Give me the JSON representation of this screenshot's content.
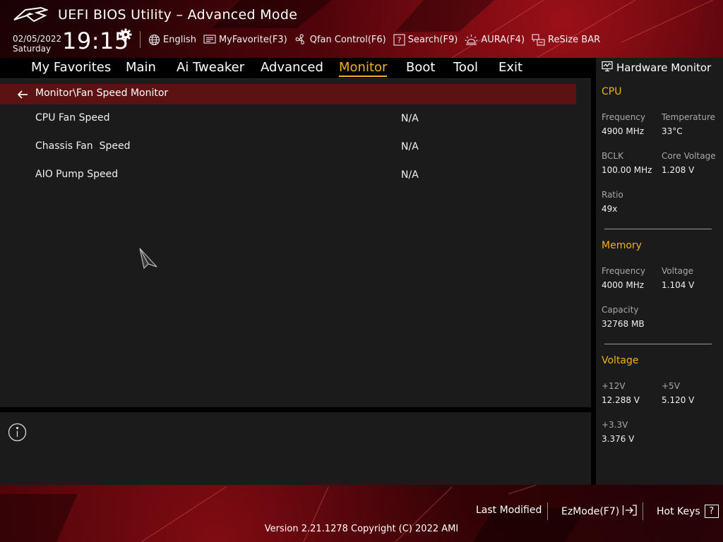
{
  "header": {
    "title": "UEFI BIOS Utility – Advanced Mode",
    "date": "02/05/2022",
    "day": "Saturday",
    "time": "19:15"
  },
  "toolbar": {
    "items": [
      {
        "label": "English",
        "icon": "globe-icon"
      },
      {
        "label": "MyFavorite(F3)",
        "icon": "favorite-icon"
      },
      {
        "label": "Qfan Control(F6)",
        "icon": "fan-icon"
      },
      {
        "label": "Search(F9)",
        "icon": "search-help-icon"
      },
      {
        "label": "AURA(F4)",
        "icon": "aura-light-icon"
      },
      {
        "label": "ReSize BAR",
        "icon": "resize-bar-icon"
      }
    ]
  },
  "menu": {
    "tabs": [
      {
        "label": "My Favorites"
      },
      {
        "label": "Main"
      },
      {
        "label": "Ai Tweaker"
      },
      {
        "label": "Advanced"
      },
      {
        "label": "Monitor"
      },
      {
        "label": "Boot"
      },
      {
        "label": "Tool"
      },
      {
        "label": "Exit"
      }
    ],
    "active": "Monitor"
  },
  "page": {
    "breadcrumb": "Monitor\\Fan Speed Monitor",
    "rows": [
      {
        "label": "CPU Fan Speed",
        "value": "N/A"
      },
      {
        "label": "Chassis Fan  Speed",
        "value": "N/A"
      },
      {
        "label": "AIO Pump Speed",
        "value": "N/A"
      }
    ]
  },
  "hardware_monitor": {
    "title": "Hardware Monitor",
    "cpu": {
      "title": "CPU",
      "frequency_label": "Frequency",
      "frequency": "4900 MHz",
      "temperature_label": "Temperature",
      "temperature": "33°C",
      "bclk_label": "BCLK",
      "bclk": "100.00 MHz",
      "core_voltage_label": "Core Voltage",
      "core_voltage": "1.208 V",
      "ratio_label": "Ratio",
      "ratio": "49x"
    },
    "memory": {
      "title": "Memory",
      "frequency_label": "Frequency",
      "frequency": "4000 MHz",
      "voltage_label": "Voltage",
      "voltage": "1.104 V",
      "capacity_label": "Capacity",
      "capacity": "32768 MB"
    },
    "voltage": {
      "title": "Voltage",
      "v12_label": "+12V",
      "v12": "12.288 V",
      "v5_label": "+5V",
      "v5": "5.120 V",
      "v33_label": "+3.3V",
      "v33": "3.376 V"
    }
  },
  "footer": {
    "last_modified": "Last Modified",
    "ezmode": "EzMode(F7)",
    "hot_keys": "Hot Keys",
    "hot_keys_glyph": "?",
    "version": "Version 2.21.1278 Copyright (C) 2022 AMI"
  },
  "colors": {
    "accent": "#f2b01e",
    "breadcrumb_bg": "#5a1212",
    "panel_bg": "#1b1b1b"
  }
}
